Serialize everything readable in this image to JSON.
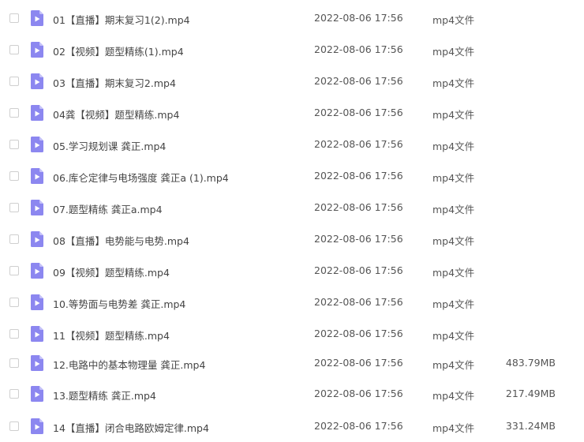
{
  "colors": {
    "icon_fill": "#8c87f0",
    "icon_fold": "#c4c1f9",
    "text": "#444444",
    "checkbox_border": "#cfcfcf"
  },
  "file_icon": "video-file-icon",
  "files": [
    {
      "name": "01【直播】期末复习1(2).mp4",
      "date": "2022-08-06 17:56",
      "type": "mp4文件",
      "size": ""
    },
    {
      "name": "02【视频】题型精练(1).mp4",
      "date": "2022-08-06 17:56",
      "type": "mp4文件",
      "size": ""
    },
    {
      "name": "03【直播】期末复习2.mp4",
      "date": "2022-08-06 17:56",
      "type": "mp4文件",
      "size": ""
    },
    {
      "name": "04龚【视频】题型精练.mp4",
      "date": "2022-08-06 17:56",
      "type": "mp4文件",
      "size": ""
    },
    {
      "name": "05.学习规划课 龚正.mp4",
      "date": "2022-08-06 17:56",
      "type": "mp4文件",
      "size": ""
    },
    {
      "name": "06.库仑定律与电场强度 龚正a (1).mp4",
      "date": "2022-08-06 17:56",
      "type": "mp4文件",
      "size": ""
    },
    {
      "name": "07.题型精练 龚正a.mp4",
      "date": "2022-08-06 17:56",
      "type": "mp4文件",
      "size": ""
    },
    {
      "name": "08【直播】电势能与电势.mp4",
      "date": "2022-08-06 17:56",
      "type": "mp4文件",
      "size": ""
    },
    {
      "name": "09【视频】题型精练.mp4",
      "date": "2022-08-06 17:56",
      "type": "mp4文件",
      "size": ""
    },
    {
      "name": "10.等势面与电势差 龚正.mp4",
      "date": "2022-08-06 17:56",
      "type": "mp4文件",
      "size": ""
    },
    {
      "name": "11【视频】题型精练.mp4",
      "date": "2022-08-06 17:56",
      "type": "mp4文件",
      "size": ""
    },
    {
      "name": "12.电路中的基本物理量 龚正.mp4",
      "date": "2022-08-06 17:56",
      "type": "mp4文件",
      "size": "483.79MB"
    },
    {
      "name": "13.题型精练 龚正.mp4",
      "date": "2022-08-06 17:56",
      "type": "mp4文件",
      "size": "217.49MB"
    },
    {
      "name": "14【直播】闭合电路欧姆定律.mp4",
      "date": "2022-08-06 17:56",
      "type": "mp4文件",
      "size": "331.24MB"
    }
  ]
}
